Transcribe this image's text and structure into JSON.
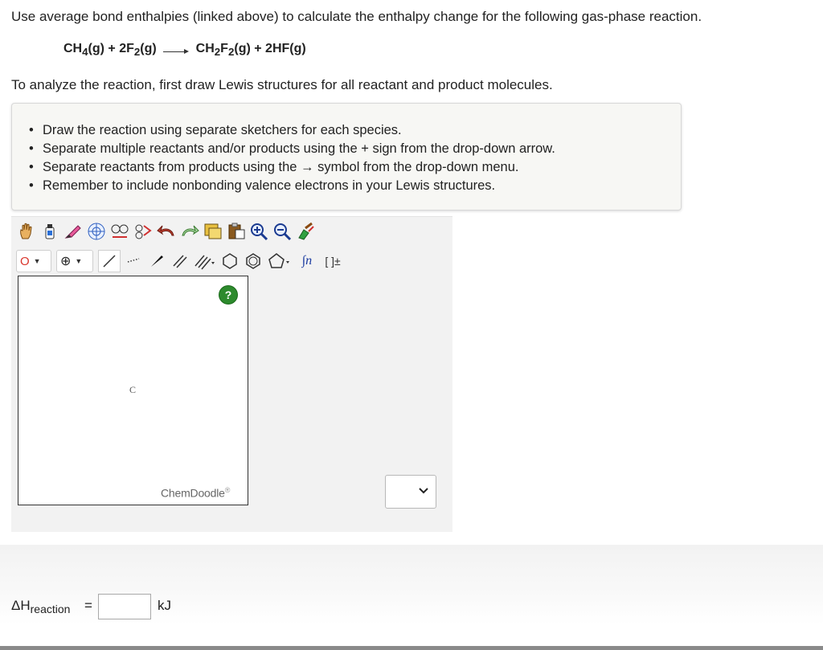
{
  "question": {
    "intro": "Use average bond enthalpies (linked above) to calculate the enthalpy change for the following gas-phase reaction.",
    "equation": {
      "reactant1": "CH",
      "reactant1_sub": "4",
      "reactant1_state": "(g)",
      "plus1": " + ",
      "reactant2": "2F",
      "reactant2_sub": "2",
      "reactant2_state": "(g)",
      "product1a": "CH",
      "product1a_sub": "2",
      "product1b": "F",
      "product1b_sub": "2",
      "product1_state": "(g)",
      "plus2": " + ",
      "product2": "2HF(g)"
    },
    "analyze": "To analyze the reaction, first draw Lewis structures for all reactant and product molecules."
  },
  "instructions": [
    "Draw the reaction using separate sketchers for each species.",
    "Separate multiple reactants and/or products using the + sign from the drop-down arrow.",
    "Separate reactants from products using the → symbol from the drop-down menu.",
    "Remember to include nonbonding valence electrons in your Lewis structures."
  ],
  "sketcher": {
    "element_label": "O",
    "charge_label": "⊕",
    "template_labels": [
      "∫n",
      "[ ]±"
    ],
    "help_label": "?",
    "atom_label": "C",
    "brand": "ChemDoodle",
    "brand_mark": "®",
    "icons": [
      "hand-icon",
      "eraser-icon",
      "lasso-icon",
      "center-icon",
      "ring-flip-icon",
      "perspective-icon",
      "undo-icon",
      "redo-icon",
      "copy-icon",
      "paste-icon",
      "zoom-in-icon",
      "zoom-out-icon",
      "clean-icon"
    ]
  },
  "answer": {
    "label": "ΔH",
    "label_sub": "reaction",
    "equals": "=",
    "value": "",
    "unit": "kJ"
  },
  "colors": {
    "help_green": "#2d8a2d",
    "element_red": "#d9342b"
  }
}
